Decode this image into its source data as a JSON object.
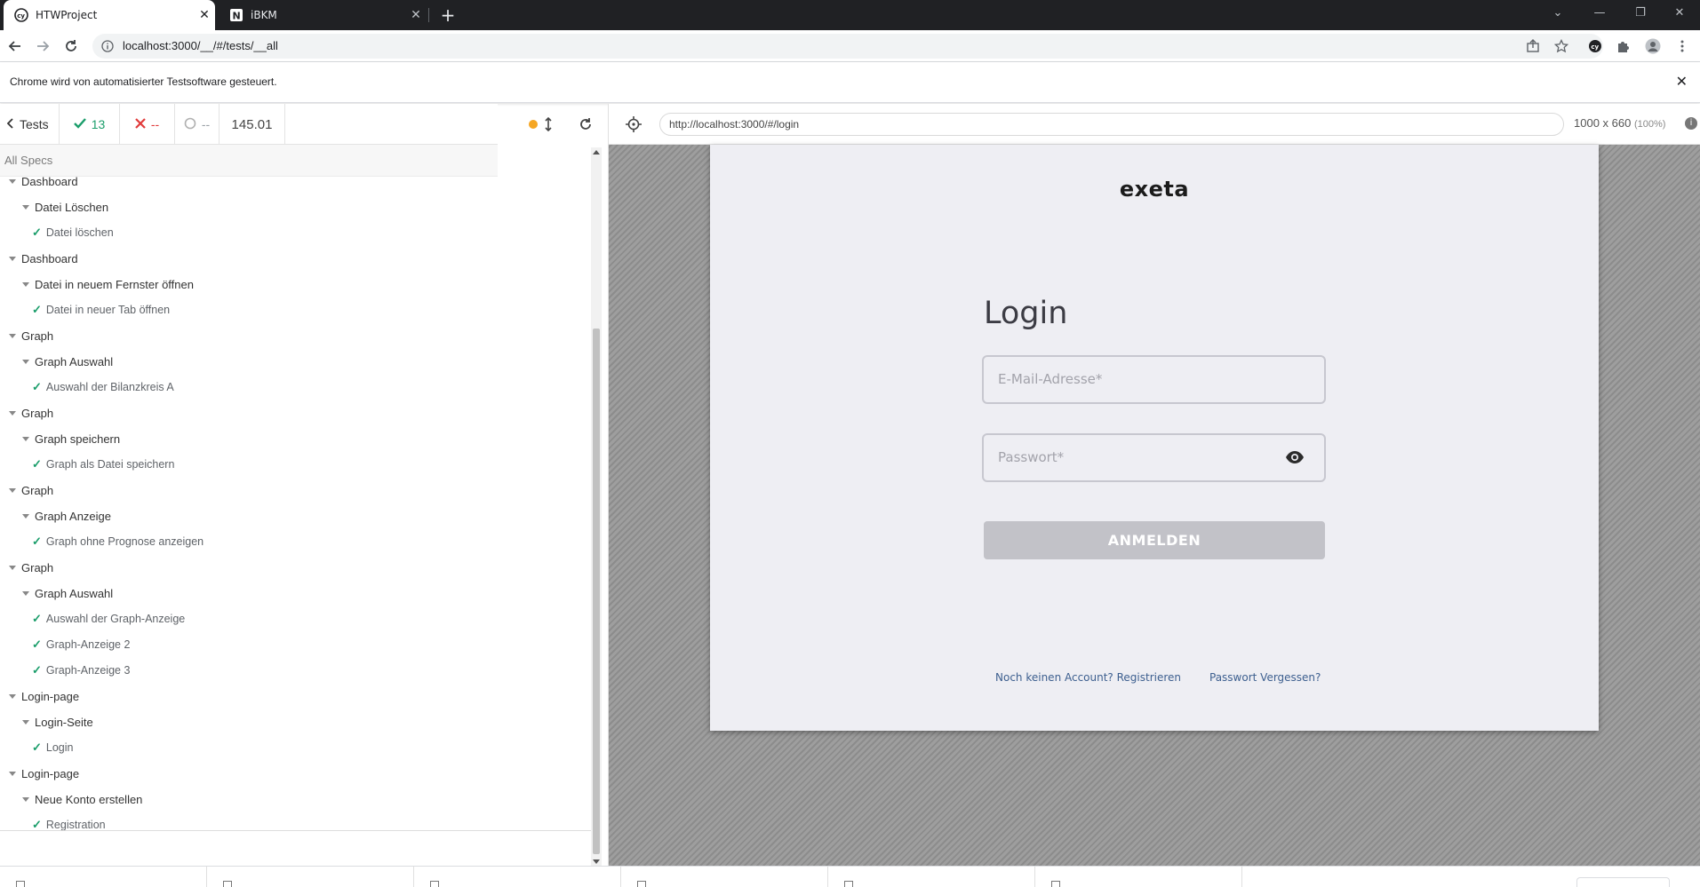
{
  "browser": {
    "tabs": [
      {
        "title": "HTWProject",
        "favicon": "cypress-icon",
        "active": true
      },
      {
        "title": "iBKM",
        "favicon": "ibkm-icon",
        "active": false
      }
    ],
    "url": "localhost:3000/__/#/tests/__all",
    "infobar_message": "Chrome wird von automatisierter Testsoftware gesteuert."
  },
  "reporter": {
    "back_label": "Tests",
    "passed": "13",
    "failed": "--",
    "pending": "--",
    "duration": "145.01",
    "all_specs_label": "All Specs",
    "rows": [
      {
        "level": 0,
        "kind": "suite",
        "label": "Dashboard"
      },
      {
        "level": 1,
        "kind": "suite",
        "label": "Datei Löschen"
      },
      {
        "level": 2,
        "kind": "test",
        "label": "Datei löschen"
      },
      {
        "level": 0,
        "kind": "suite",
        "label": "Dashboard"
      },
      {
        "level": 1,
        "kind": "suite",
        "label": "Datei in neuem Fernster öffnen"
      },
      {
        "level": 2,
        "kind": "test",
        "label": "Datei in neuer Tab öffnen"
      },
      {
        "level": 0,
        "kind": "suite",
        "label": "Graph"
      },
      {
        "level": 1,
        "kind": "suite",
        "label": "Graph Auswahl"
      },
      {
        "level": 2,
        "kind": "test",
        "label": "Auswahl der Bilanzkreis A"
      },
      {
        "level": 0,
        "kind": "suite",
        "label": "Graph"
      },
      {
        "level": 1,
        "kind": "suite",
        "label": "Graph speichern"
      },
      {
        "level": 2,
        "kind": "test",
        "label": "Graph als Datei speichern"
      },
      {
        "level": 0,
        "kind": "suite",
        "label": "Graph"
      },
      {
        "level": 1,
        "kind": "suite",
        "label": "Graph Anzeige"
      },
      {
        "level": 2,
        "kind": "test",
        "label": "Graph ohne Prognose anzeigen"
      },
      {
        "level": 0,
        "kind": "suite",
        "label": "Graph"
      },
      {
        "level": 1,
        "kind": "suite",
        "label": "Graph Auswahl"
      },
      {
        "level": 2,
        "kind": "test",
        "label": "Auswahl der Graph-Anzeige"
      },
      {
        "level": 2,
        "kind": "test",
        "label": "Graph-Anzeige 2"
      },
      {
        "level": 2,
        "kind": "test",
        "label": "Graph-Anzeige 3"
      },
      {
        "level": 0,
        "kind": "suite",
        "label": "Login-page"
      },
      {
        "level": 1,
        "kind": "suite",
        "label": "Login-Seite"
      },
      {
        "level": 2,
        "kind": "test",
        "label": "Login"
      },
      {
        "level": 0,
        "kind": "suite",
        "label": "Login-page"
      },
      {
        "level": 1,
        "kind": "suite",
        "label": "Neue Konto erstellen"
      },
      {
        "level": 2,
        "kind": "test",
        "label": "Registration"
      }
    ]
  },
  "aut": {
    "url": "http://localhost:3000/#/login",
    "viewport": "1000 x 660",
    "zoom": "(100%)"
  },
  "app": {
    "logo": "exeta",
    "title": "Login",
    "email_placeholder": "E-Mail-Adresse*",
    "password_placeholder": "Passwort*",
    "login_button": "ANMELDEN",
    "register_link": "Noch keinen Account? Registrieren",
    "forgot_link": "Passwort Vergessen?"
  },
  "colors": {
    "passed": "#1a9d6a",
    "failed": "#e13a3a",
    "running_dot": "#f5a623",
    "link": "#3d5f8f",
    "button_disabled": "#c2c2c8"
  }
}
